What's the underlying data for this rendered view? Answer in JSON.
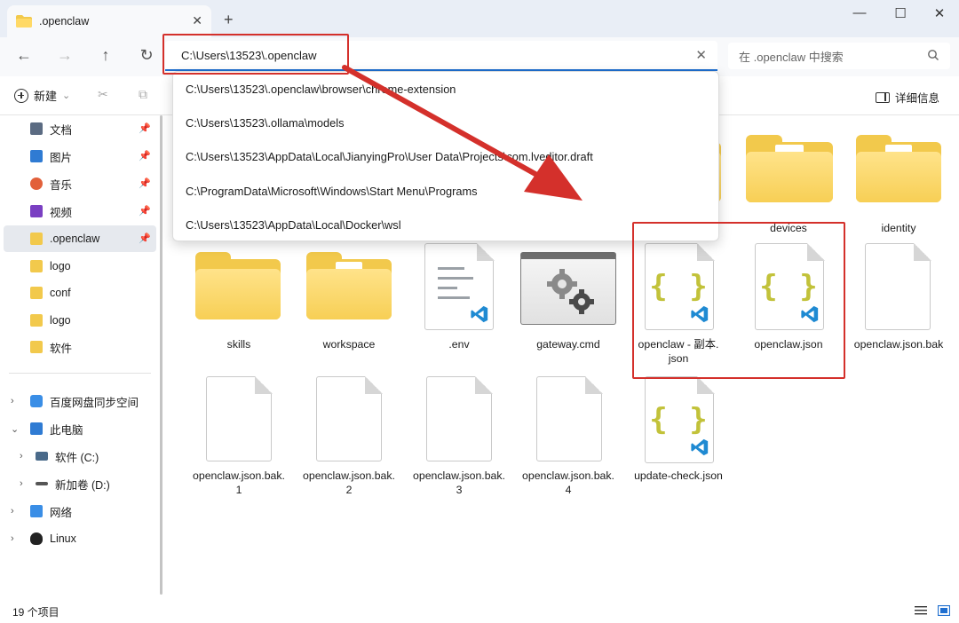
{
  "window": {
    "tab_title": ".openclaw",
    "tab_close": "✕",
    "new_tab": "+",
    "minimize": "—",
    "maximize": "☐",
    "close": "✕"
  },
  "nav": {
    "back": "←",
    "forward": "→",
    "up": "↑",
    "refresh": "↻"
  },
  "address": {
    "value": "C:\\Users\\13523\\.openclaw",
    "clear": "✕"
  },
  "search": {
    "placeholder": "在 .openclaw 中搜索"
  },
  "toolbar": {
    "new_label": "新建",
    "new_caret": "⌄",
    "cut_icon": "✂",
    "copy_icon": "⧉",
    "details_label": "详细信息"
  },
  "dropdown": {
    "items": [
      "C:\\Users\\13523\\.openclaw\\browser\\chrome-extension",
      "C:\\Users\\13523\\.ollama\\models",
      "C:\\Users\\13523\\AppData\\Local\\JianyingPro\\User Data\\Projects\\com.lveditor.draft",
      "C:\\ProgramData\\Microsoft\\Windows\\Start Menu\\Programs",
      "C:\\Users\\13523\\AppData\\Local\\Docker\\wsl"
    ]
  },
  "sidebar": {
    "quick": [
      {
        "label": "文档",
        "icon": "document-icon",
        "color": "#5b6b82"
      },
      {
        "label": "图片",
        "icon": "pictures-icon",
        "color": "#2f7bd3"
      },
      {
        "label": "音乐",
        "icon": "music-icon",
        "color": "#e2603a"
      },
      {
        "label": "视频",
        "icon": "video-icon",
        "color": "#7a3fc2"
      },
      {
        "label": ".openclaw",
        "icon": "folder-icon",
        "color": "#f2c94c"
      },
      {
        "label": "logo",
        "icon": "folder-icon",
        "color": "#f2c94c"
      },
      {
        "label": "conf",
        "icon": "folder-icon",
        "color": "#f2c94c"
      },
      {
        "label": "logo",
        "icon": "folder-icon",
        "color": "#f2c94c"
      },
      {
        "label": "软件",
        "icon": "folder-icon",
        "color": "#f2c94c"
      }
    ],
    "tree": [
      {
        "label": "百度网盘同步空间",
        "icon": "cloud-sync-icon"
      },
      {
        "label": "此电脑",
        "icon": "computer-icon"
      },
      {
        "label": "软件 (C:)",
        "icon": "drive-c-icon"
      },
      {
        "label": "新加卷 (D:)",
        "icon": "drive-d-icon"
      },
      {
        "label": "网络",
        "icon": "network-icon"
      },
      {
        "label": "Linux",
        "icon": "linux-icon"
      }
    ]
  },
  "files": {
    "devices": "devices",
    "identity": "identity",
    "skills": "skills",
    "workspace": "workspace",
    "env": ".env",
    "gateway": "gateway.cmd",
    "copy_json_1": "openclaw - 副本.",
    "copy_json_2": "json",
    "openclaw_json": "openclaw.json",
    "bak": "openclaw.json.bak",
    "bak1_a": "openclaw.json.bak.",
    "bak1_b": "1",
    "bak2_a": "openclaw.json.bak.",
    "bak2_b": "2",
    "bak3_a": "openclaw.json.bak.",
    "bak3_b": "3",
    "bak4_a": "openclaw.json.bak.",
    "bak4_b": "4",
    "update_check": "update-check.json",
    "braces": "{ }"
  },
  "status": {
    "count": "19 个项目"
  },
  "colors": {
    "accent": "#1f6fd0",
    "annotation_red": "#d4302b",
    "folder": "#f2c94c",
    "vscode_blue": "#1f8ad2",
    "json_braces": "#c2c23a"
  }
}
